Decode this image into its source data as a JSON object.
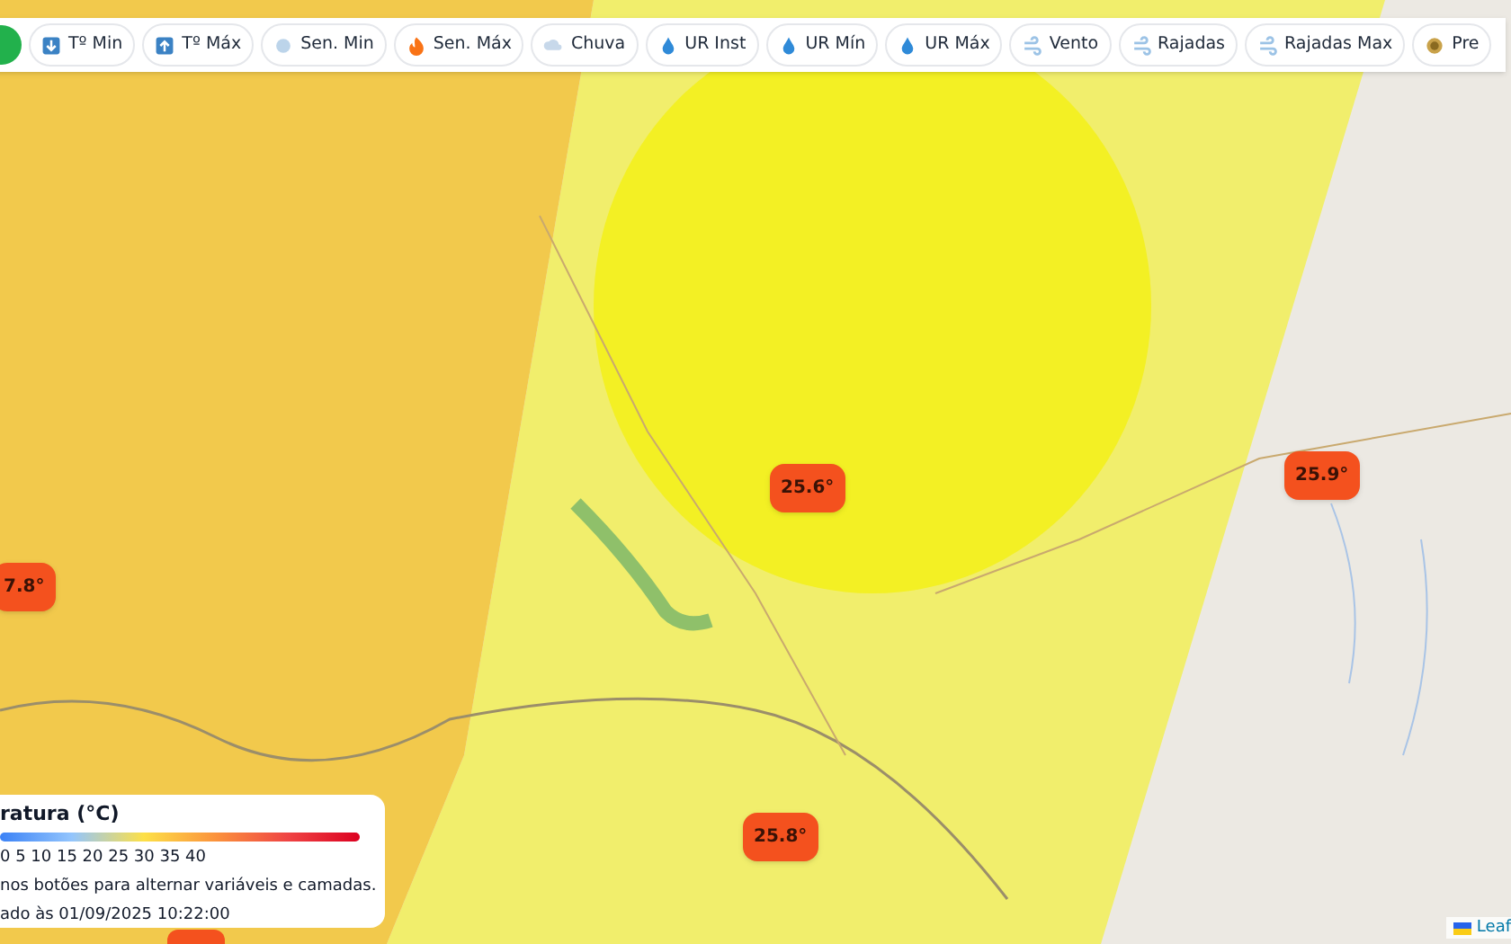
{
  "toolbar": {
    "buttons": [
      {
        "label": "Tº Min"
      },
      {
        "label": "Tº Máx"
      },
      {
        "label": "Sen. Min"
      },
      {
        "label": "Sen. Máx"
      },
      {
        "label": "Chuva"
      },
      {
        "label": "UR Inst"
      },
      {
        "label": "UR Mín"
      },
      {
        "label": "UR Máx"
      },
      {
        "label": "Vento"
      },
      {
        "label": "Rajadas"
      },
      {
        "label": "Rajadas Max"
      },
      {
        "label": "Pre"
      }
    ]
  },
  "markers": [
    {
      "text": "25.6°"
    },
    {
      "text": "25.9°"
    },
    {
      "text": "7.8°"
    },
    {
      "text": "25.8°"
    }
  ],
  "legend": {
    "title": "ratura (°C)",
    "scale": "0 5 10 15 20 25 30 35 40",
    "hint": "nos botões para alternar variáveis e camadas.",
    "updated": "ado às 01/09/2025 10:22:00"
  },
  "attribution": "Leaf"
}
